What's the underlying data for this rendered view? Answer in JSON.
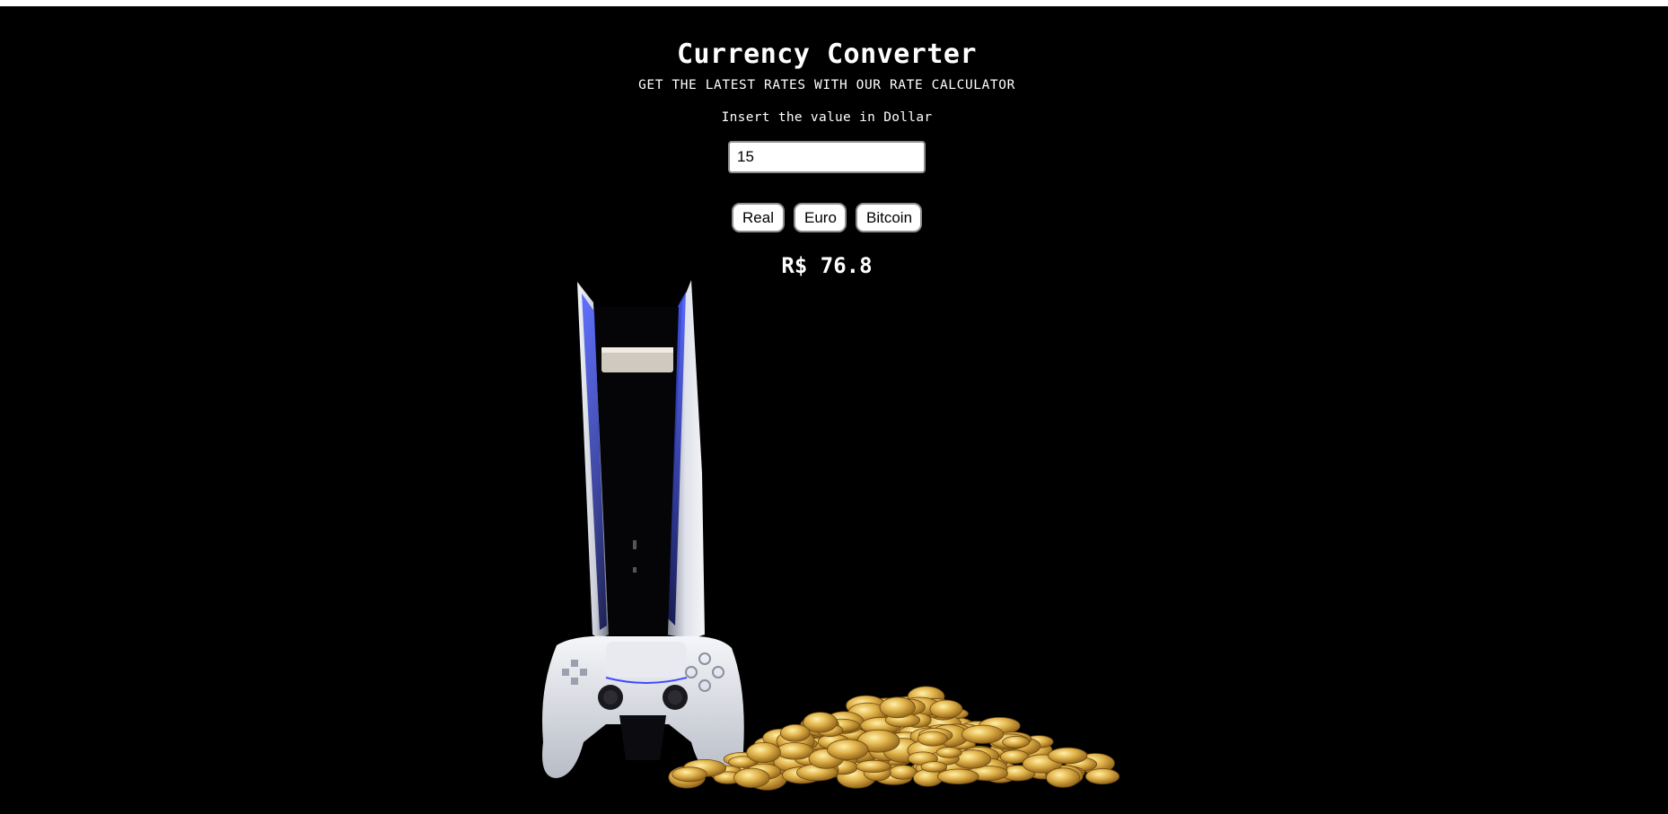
{
  "app": {
    "title": "Currency Converter",
    "subtitle": "GET THE LATEST RATES WITH OUR RATE CALCULATOR",
    "prompt": "Insert the value in Dollar"
  },
  "input": {
    "value": "15"
  },
  "buttons": {
    "real": "Real",
    "euro": "Euro",
    "bitcoin": "Bitcoin"
  },
  "result": {
    "text": "R$ 76.8"
  },
  "colors": {
    "background": "#000000",
    "text": "#ffffff",
    "accent_glow": "#2a3cff",
    "coin": "#d4a23a"
  },
  "images": {
    "console": "console-with-controller-image",
    "coins": "gold-coin-pile-image"
  }
}
